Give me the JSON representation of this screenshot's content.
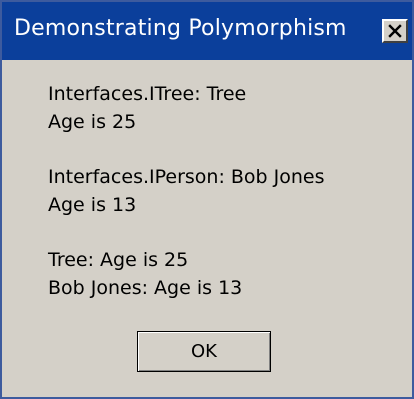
{
  "window": {
    "title": "Demonstrating Polymorphism",
    "close_label": "X"
  },
  "message": {
    "lines": [
      "Interfaces.ITree: Tree",
      "Age is 25",
      "Interfaces.IPerson: Bob Jones",
      "Age is 13",
      "Tree: Age is 25",
      "Bob Jones: Age is 13"
    ]
  },
  "buttons": {
    "ok_label": "OK"
  }
}
